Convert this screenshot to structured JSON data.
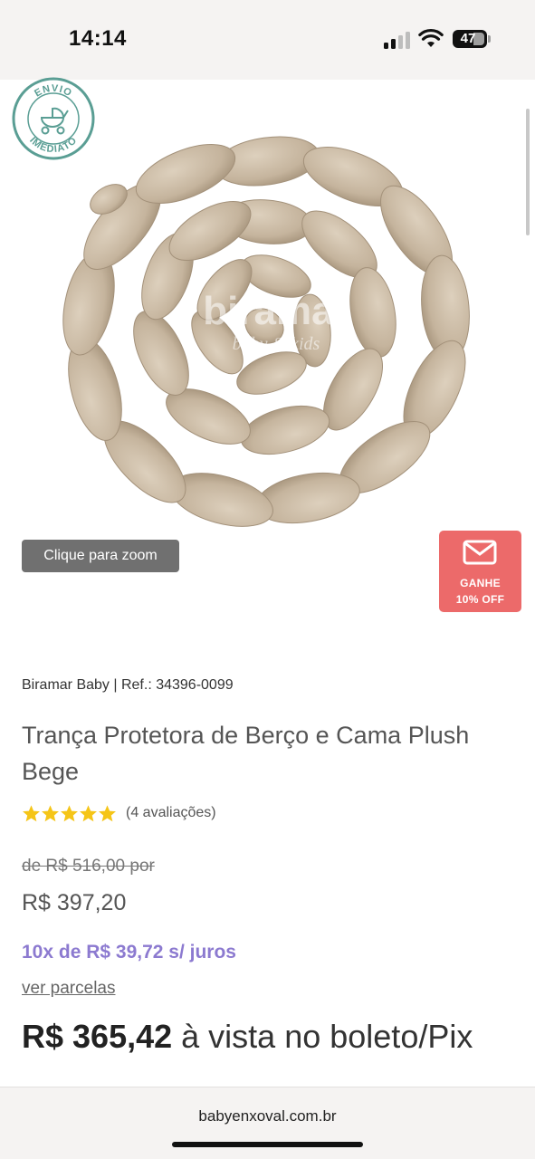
{
  "status_bar": {
    "time": "14:14",
    "battery": "47",
    "icons": [
      "cellular-signal-icon",
      "wifi-icon",
      "battery-icon"
    ]
  },
  "product_image": {
    "badge_text_top": "ENVIO",
    "badge_text_bottom": "IMEDIATO",
    "watermark_main": "biramar",
    "watermark_sub": "baby & kids",
    "zoom_button": "Clique para zoom",
    "promo_badge": {
      "line1": "GANHE",
      "line2": "10% OFF",
      "icon": "mail-icon"
    }
  },
  "product": {
    "brand_ref": "Biramar Baby | Ref.: 34396-0099",
    "title": "Trança Protetora de Berço e Cama Plush Bege",
    "rating_stars": 5,
    "rating_count": "(4 avaliações)",
    "old_price": "de R$ 516,00 por",
    "price": "R$ 397,20",
    "installments": "10x de R$ 39,72 s/ juros",
    "ver_parcelas": "ver parcelas",
    "cash_price": "R$ 365,42",
    "cash_suffix": "à vista no boleto/Pix"
  },
  "browser": {
    "url": "babyenxoval.com.br"
  },
  "colors": {
    "promo": "#ec6a6a",
    "installments": "#8c7ad0",
    "star": "#f5c518",
    "badge_green": "#5a9e94",
    "braid": "#c8b9a3"
  }
}
